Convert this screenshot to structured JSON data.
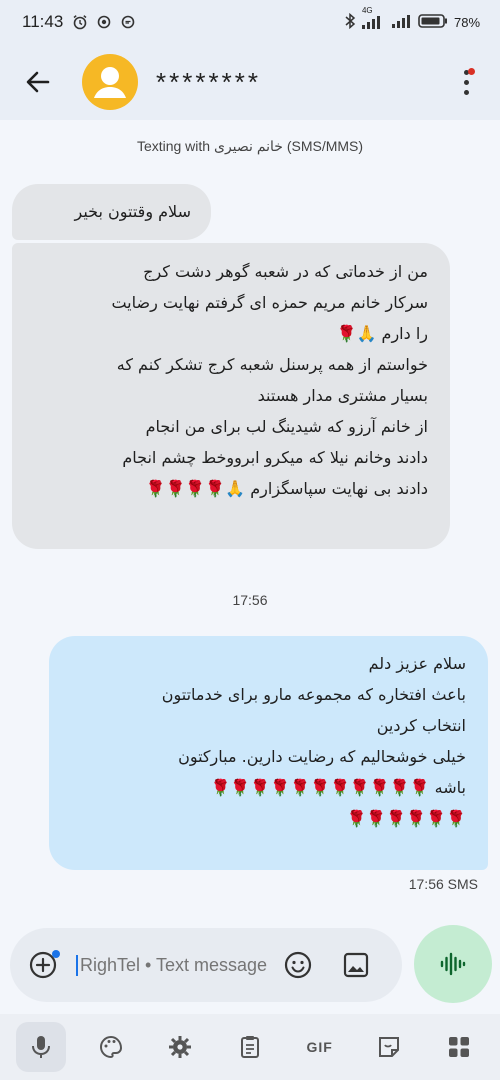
{
  "status_bar": {
    "time": "11:43",
    "network": "4G",
    "battery": "78",
    "icons": [
      "alarm-icon",
      "dot-icon",
      "whatsapp-icon",
      "bluetooth-icon",
      "signal-icon",
      "battery-icon"
    ]
  },
  "header": {
    "contact_name": "********",
    "icons": [
      "back-arrow-icon",
      "avatar-icon",
      "more-icon"
    ]
  },
  "conversation": {
    "texting_note": "Texting with خانم نصیری (SMS/MMS)",
    "incoming": [
      {
        "text": "سلام وقتتون بخیر"
      },
      {
        "text": "من از خدماتی که در شعبه گوهر دشت کرج\nسرکار خانم مریم حمزه ای گرفتم نهایت رضایت\nرا دارم 🙏🌹\nخواستم از همه پرسنل شعبه کرج تشکر کنم که\nبسیار مشتری مدار هستند\nاز خانم آرزو که شیدینگ لب برای من انجام\nدادند وخانم نیلا که میکرو ابرووخط چشم انجام\nدادند بی نهایت سپاسگزارم 🙏🌹🌹🌹🌹"
      }
    ],
    "time_separator": "17:56",
    "outgoing": [
      {
        "text": "سلام عزیز دلم\nباعث افتخاره که مجموعه مارو برای خدماتتون\nانتخاب کردین\nخیلی خوشحالیم که رضایت دارین. مبارکتون\nباشه 🌹🌹🌹🌹🌹🌹🌹🌹🌹🌹🌹\n🌹🌹🌹🌹🌹🌹",
        "meta": "17:56 SMS"
      }
    ]
  },
  "compose": {
    "placeholder": "RighTel • Text message",
    "icons": [
      "add-icon",
      "emoji-icon",
      "image-icon",
      "voice-wave-icon"
    ]
  },
  "keyboard_toolbar": {
    "gif_label": "GIF",
    "icons": [
      "microphone-icon",
      "palette-icon",
      "settings-icon",
      "clipboard-icon",
      "gif-icon",
      "sticker-icon",
      "apps-grid-icon"
    ]
  },
  "colors": {
    "background": "#f3f6fb",
    "header": "#e9eef6",
    "incoming_bubble": "#e3e5e8",
    "outgoing_bubble": "#cde8fb",
    "avatar": "#f6b825",
    "voice_button": "#c4ecd2",
    "accent": "#1a73e8"
  }
}
